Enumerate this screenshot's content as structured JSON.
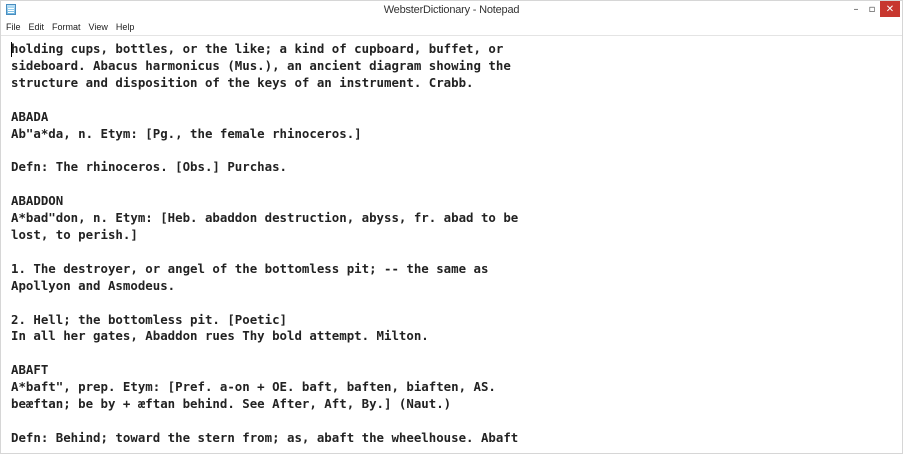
{
  "window": {
    "title": "WebsterDictionary - Notepad",
    "minimize_glyph": "–",
    "maximize_glyph": "▫",
    "close_glyph": "✕"
  },
  "menu": {
    "items": [
      "File",
      "Edit",
      "Format",
      "View",
      "Help"
    ]
  },
  "icons": {
    "app": "notepad-icon",
    "minimize": "minimize-icon",
    "maximize": "maximize-icon",
    "close": "close-icon"
  },
  "colors": {
    "close_button": "#c7372f",
    "text": "#222222"
  },
  "editor": {
    "content": "holding cups, bottles, or the like; a kind of cupboard, buffet, or\nsideboard. Abacus harmonicus (Mus.), an ancient diagram showing the\nstructure and disposition of the keys of an instrument. Crabb.\n\nABADA\nAb\"a*da, n. Etym: [Pg., the female rhinoceros.]\n\nDefn: The rhinoceros. [Obs.] Purchas.\n\nABADDON\nA*bad\"don, n. Etym: [Heb. abaddon destruction, abyss, fr. abad to be\nlost, to perish.]\n\n1. The destroyer, or angel of the bottomless pit; -- the same as\nApollyon and Asmodeus.\n\n2. Hell; the bottomless pit. [Poetic]\nIn all her gates, Abaddon rues Thy bold attempt. Milton.\n\nABAFT\nA*baft\", prep. Etym: [Pref. a-on + OE. baft, baften, biaften, AS.\nbeæftan; be by + æftan behind. See After, Aft, By.] (Naut.)\n\nDefn: Behind; toward the stern from; as, abaft the wheelhouse. Abaft"
  }
}
